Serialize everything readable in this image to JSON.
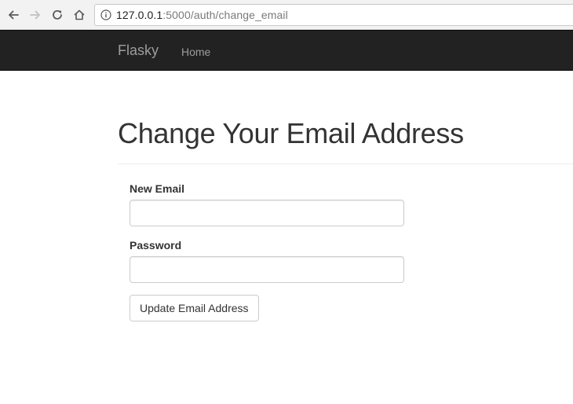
{
  "browser": {
    "url_host": "127.0.0.1",
    "url_rest": ":5000/auth/change_email",
    "icons": {
      "back": "back-arrow-icon",
      "forward": "forward-arrow-icon",
      "reload": "reload-icon",
      "home": "home-icon",
      "info": "info-icon"
    }
  },
  "navbar": {
    "brand": "Flasky",
    "links": [
      {
        "label": "Home"
      }
    ],
    "background": "#222222",
    "link_color": "#9d9d9d"
  },
  "page": {
    "title": "Change Your Email Address"
  },
  "form": {
    "email_label": "New Email",
    "email_value": "",
    "password_label": "Password",
    "password_value": "",
    "submit_label": "Update Email Address"
  }
}
